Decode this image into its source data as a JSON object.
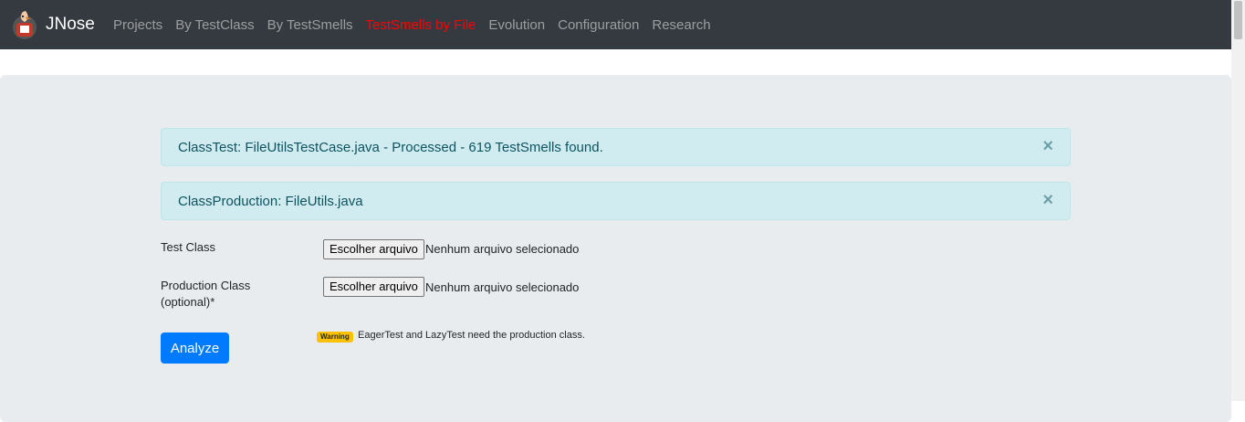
{
  "navbar": {
    "brand": "JNose",
    "logo_icon": "jnose-mascot-icon",
    "links": [
      {
        "label": "Projects",
        "active": false
      },
      {
        "label": "By TestClass",
        "active": false
      },
      {
        "label": "By TestSmells",
        "active": false
      },
      {
        "label": "TestSmells by File",
        "active": true
      },
      {
        "label": "Evolution",
        "active": false
      },
      {
        "label": "Configuration",
        "active": false
      },
      {
        "label": "Research",
        "active": false
      }
    ],
    "active_color": "#ff0000"
  },
  "alerts": [
    {
      "message": "ClassTest: FileUtilsTestCase.java - Processed - 619 TestSmells found.",
      "close": "×"
    },
    {
      "message": "ClassProduction: FileUtils.java",
      "close": "×"
    }
  ],
  "form": {
    "test_class": {
      "label": "Test Class",
      "button": "Escolher arquivo",
      "status": "Nenhum arquivo selecionado"
    },
    "production_class": {
      "label_line1": "Production Class",
      "label_line2": "(optional)*",
      "button": "Escolher arquivo",
      "status": "Nenhum arquivo selecionado"
    },
    "analyze_label": "Analyze",
    "warning_badge": "Warning",
    "warning_text": "EagerTest and LazyTest need the production class."
  },
  "colors": {
    "navbar_bg": "#343a40",
    "alert_bg": "#d1ecf1",
    "primary": "#007bff",
    "warning": "#ffc107"
  }
}
